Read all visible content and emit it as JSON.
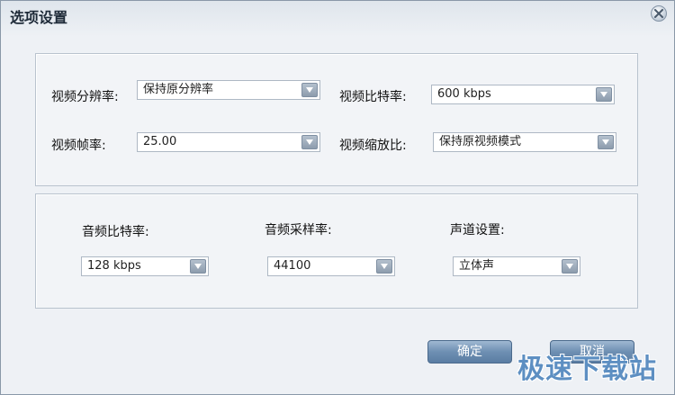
{
  "window": {
    "title": "选项设置"
  },
  "video": {
    "resolution": {
      "label": "视频分辨率:",
      "value": "保持原分辨率"
    },
    "bitrate": {
      "label": "视频比特率:",
      "value": "600 kbps"
    },
    "framerate": {
      "label": "视频帧率:",
      "value": "25.00"
    },
    "aspect": {
      "label": "视频缩放比:",
      "value": "保持原视频模式"
    }
  },
  "audio": {
    "bitrate": {
      "label": "音频比特率:",
      "value": "128 kbps"
    },
    "samplerate": {
      "label": "音频采样率:",
      "value": "44100"
    },
    "channels": {
      "label": "声道设置:",
      "value": "立体声"
    }
  },
  "buttons": {
    "ok": "确定",
    "cancel": "取消"
  },
  "watermark": "极速下载站",
  "icons": {
    "close": "close-icon",
    "dropdown": "chevron-down-icon"
  },
  "colors": {
    "button": "#6e8fb2",
    "watermark": "#5d8fc2",
    "border": "#b9c3ce"
  }
}
